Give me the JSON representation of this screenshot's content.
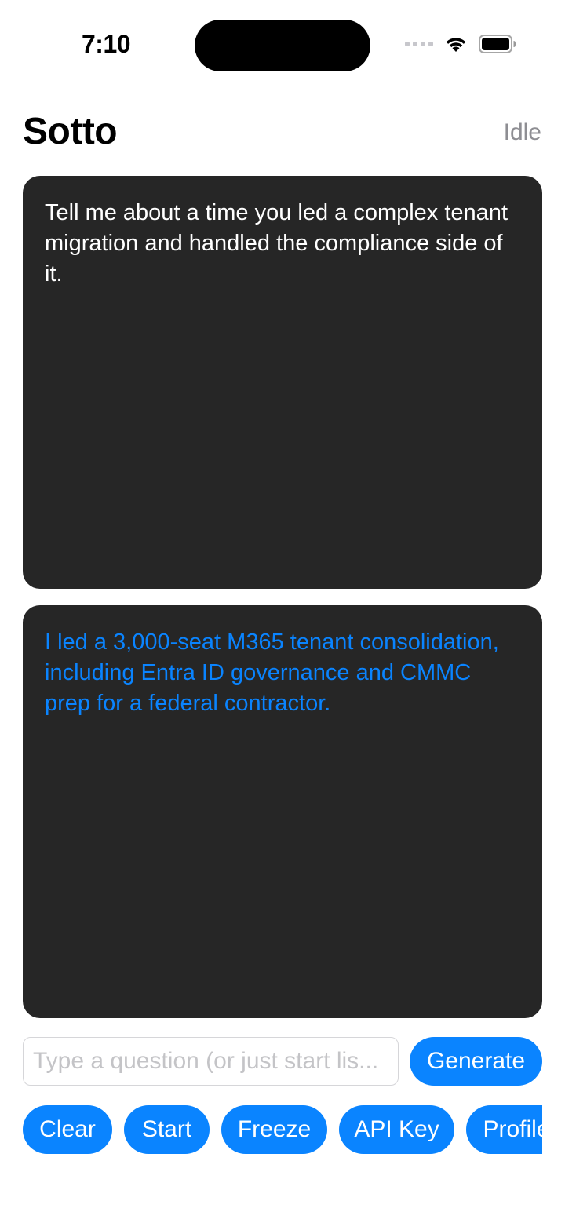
{
  "status_bar": {
    "time": "7:10",
    "icons": [
      "cellular-signal-icon",
      "wifi-icon",
      "battery-icon"
    ]
  },
  "header": {
    "title": "Sotto",
    "status": "Idle"
  },
  "question_panel": {
    "text": "Tell me about a time you led a complex tenant migration and handled the compliance side of it."
  },
  "answer_panel": {
    "text": "I led a 3,000-seat M365 tenant consolidation, including Entra ID governance and CMMC prep for a federal contractor."
  },
  "input": {
    "value": "",
    "placeholder": "Type a question (or just start lis..."
  },
  "buttons": {
    "generate": "Generate",
    "clear": "Clear",
    "start": "Start",
    "freeze": "Freeze",
    "api_key": "API Key",
    "profile": "Profile"
  },
  "colors": {
    "accent": "#0a84ff",
    "panel_bg": "#262626",
    "muted_text": "#8e8e93"
  }
}
